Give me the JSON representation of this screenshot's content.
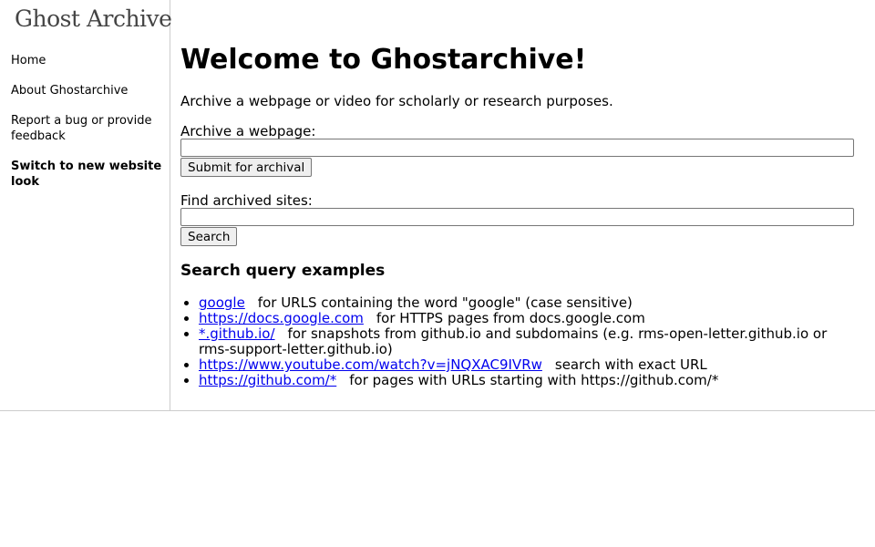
{
  "sidebar": {
    "logo": "Ghost Archive",
    "items": [
      {
        "label": "Home"
      },
      {
        "label": "About Ghostarchive"
      },
      {
        "label": "Report a bug or provide feedback"
      },
      {
        "label": "Switch to new website look"
      }
    ]
  },
  "main": {
    "title": "Welcome to Ghostarchive!",
    "intro": "Archive a webpage or video for scholarly or research purposes.",
    "archive": {
      "label": "Archive a webpage:",
      "value": "",
      "submit_label": "Submit for archival"
    },
    "find": {
      "label": "Find archived sites:",
      "value": "",
      "search_label": "Search"
    },
    "examples": {
      "heading": "Search query examples",
      "items": [
        {
          "query": "google",
          "desc": "for URLS containing the word \"google\" (case sensitive)"
        },
        {
          "query": "https://docs.google.com",
          "desc": "for HTTPS pages from docs.google.com"
        },
        {
          "query": "*.github.io/",
          "desc": "for snapshots from github.io and subdomains (e.g. rms-open-letter.github.io or rms-support-letter.github.io)"
        },
        {
          "query": "https://www.youtube.com/watch?v=jNQXAC9IVRw",
          "desc": "search with exact URL"
        },
        {
          "query": "https://github.com/*",
          "desc": "for pages with URLs starting with https://github.com/*"
        }
      ]
    }
  },
  "colors": {
    "link": "#0000ee",
    "divider": "#cccccc",
    "logo": "#444444"
  }
}
